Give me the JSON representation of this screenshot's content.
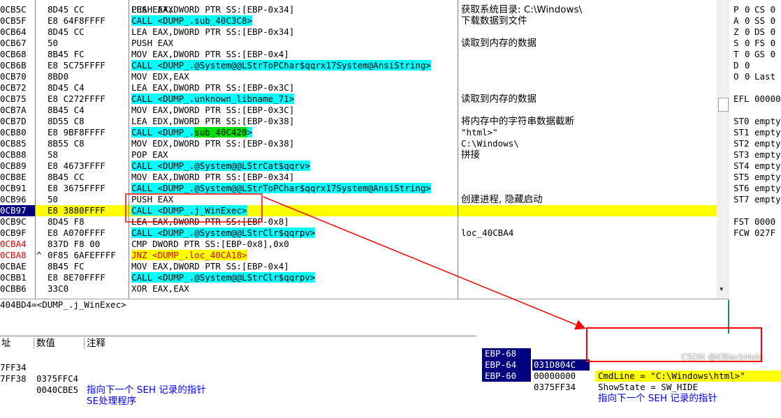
{
  "disasm": {
    "rows": [
      {
        "addr": "0CB5C",
        "mark": "",
        "hex": "8D45 CC",
        "ins": "LEA EAX,DWORD PTR SS:[EBP-0x34]",
        "cmt": "获取系统目录: C:\\Windows\\"
      },
      {
        "addr": "0CB5F",
        "mark": "",
        "hex": "E8 64F8FFFF",
        "ins": "CALL <DUMP_.sub_40C3C8>",
        "cmt": ""
      },
      {
        "addr": "0CB64",
        "mark": "",
        "hex": "8D45 CC",
        "ins": "LEA EAX,DWORD PTR SS:[EBP-0x34]",
        "cmt": ""
      },
      {
        "addr": "0CB67",
        "mark": "",
        "hex": "50",
        "ins": "PUSH EAX",
        "cmt": "读取到内存的数据"
      },
      {
        "addr": "0CB68",
        "mark": "",
        "hex": "8B45 FC",
        "ins": "MOV EAX,DWORD PTR SS:[EBP-0x4]",
        "cmt": ""
      },
      {
        "addr": "0CB6B",
        "mark": "",
        "hex": "E8 5C75FFFF",
        "ins": "CALL <DUMP_.@System@@LStrToPChar$qqrx17System@AnsiString>",
        "cmt": ""
      },
      {
        "addr": "0CB70",
        "mark": "",
        "hex": "8BD0",
        "ins": "MOV EDX,EAX",
        "cmt": ""
      },
      {
        "addr": "0CB72",
        "mark": "",
        "hex": "8D45 C4",
        "ins": "LEA EAX,DWORD PTR SS:[EBP-0x3C]",
        "cmt": ""
      },
      {
        "addr": "0CB75",
        "mark": "",
        "hex": "E8 C272FFFF",
        "ins": "CALL <DUMP_.unknown_libname_71>",
        "cmt": "读取到内存的数据"
      },
      {
        "addr": "0CB7A",
        "mark": "",
        "hex": "8B45 C4",
        "ins": "MOV EAX,DWORD PTR SS:[EBP-0x3C]",
        "cmt": ""
      },
      {
        "addr": "0CB7D",
        "mark": "",
        "hex": "8D55 C8",
        "ins": "LEA EDX,DWORD PTR SS:[EBP-0x38]",
        "cmt": "将内存中的字符串数据截断"
      },
      {
        "addr": "0CB80",
        "mark": "",
        "hex": "E8 9BF8FFFF",
        "ins": "CALL <DUMP_.sub_40C420>",
        "cmt": "\"html>\""
      },
      {
        "addr": "0CB85",
        "mark": "",
        "hex": "8B55 C8",
        "ins": "MOV EDX,DWORD PTR SS:[EBP-0x38]",
        "cmt": "C:\\Windows\\"
      },
      {
        "addr": "0CB88",
        "mark": "",
        "hex": "58",
        "ins": "POP EAX",
        "cmt": "拼接"
      },
      {
        "addr": "0CB89",
        "mark": "",
        "hex": "E8 4673FFFF",
        "ins": "CALL <DUMP_.@System@@LStrCat$qqrv>",
        "cmt": ""
      },
      {
        "addr": "0CB8E",
        "mark": "",
        "hex": "8B45 CC",
        "ins": "MOV EAX,DWORD PTR SS:[EBP-0x34]",
        "cmt": ""
      },
      {
        "addr": "0CB91",
        "mark": "",
        "hex": "E8 3675FFFF",
        "ins": "CALL <DUMP_.@System@@LStrToPChar$qqrx17System@AnsiString>",
        "cmt": ""
      },
      {
        "addr": "0CB96",
        "mark": "",
        "hex": "50",
        "ins": "PUSH EAX",
        "cmt": "创建进程, 隐藏启动"
      },
      {
        "addr": "0CB97",
        "mark": "",
        "hex": "E8 3880FFFF",
        "ins": "CALL <DUMP_.j_WinExec>",
        "cmt": ""
      },
      {
        "addr": "0CB9C",
        "mark": "",
        "hex": "8D45 F8",
        "ins": "LEA EAX,DWORD PTR SS:[EBP-0x8]",
        "cmt": ""
      },
      {
        "addr": "0CB9F",
        "mark": "",
        "hex": "E8 A070FFFF",
        "ins": "CALL <DUMP_.@System@@LStrClr$qqrpv>",
        "cmt": "loc_40CBA4"
      },
      {
        "addr": "0CBA4",
        "mark": "",
        "hex": "837D F8 00",
        "ins": "CMP DWORD PTR SS:[EBP-0x8],0x0",
        "cmt": ""
      },
      {
        "addr": "0CBA8",
        "mark": "^",
        "hex": "0F85 6AFEFFFF",
        "ins": "JNZ <DUMP_.loc_40CA18>",
        "cmt": ""
      },
      {
        "addr": "0CBAE",
        "mark": "",
        "hex": "8B45 FC",
        "ins": "MOV EAX,DWORD PTR SS:[EBP-0x4]",
        "cmt": ""
      },
      {
        "addr": "0CBB1",
        "mark": "",
        "hex": "E8 8E70FFFF",
        "ins": "CALL <DUMP_.@System@@LStrClr$qqrpv>",
        "cmt": ""
      },
      {
        "addr": "0CBB6",
        "mark": "",
        "hex": "33C0",
        "ins": "XOR EAX,EAX",
        "cmt": ""
      }
    ],
    "top_comment": "下载数据到文件"
  },
  "registers": [
    {
      "a": "P",
      "b": "0",
      "c": "CS 0"
    },
    {
      "a": "A",
      "b": "0",
      "c": "SS 0"
    },
    {
      "a": "Z",
      "b": "0",
      "c": "DS 0"
    },
    {
      "a": "S",
      "b": "0",
      "c": "FS 0"
    },
    {
      "a": "T",
      "b": "0",
      "c": "GS 0"
    },
    {
      "a": "D",
      "b": "0",
      "c": ""
    },
    {
      "a": "O",
      "b": "0",
      "c": "Last"
    },
    {
      "a": "",
      "b": "",
      "c": ""
    },
    {
      "a": "EFL",
      "b": "",
      "c": "00000"
    },
    {
      "a": "",
      "b": "",
      "c": ""
    },
    {
      "a": "ST0",
      "b": "",
      "c": "empty"
    },
    {
      "a": "ST1",
      "b": "",
      "c": "empty"
    },
    {
      "a": "ST2",
      "b": "",
      "c": "empty"
    },
    {
      "a": "ST3",
      "b": "",
      "c": "empty"
    },
    {
      "a": "ST4",
      "b": "",
      "c": "empty"
    },
    {
      "a": "ST5",
      "b": "",
      "c": "empty"
    },
    {
      "a": "ST6",
      "b": "",
      "c": "empty"
    },
    {
      "a": "ST7",
      "b": "",
      "c": "empty"
    },
    {
      "a": "",
      "b": "",
      "c": ""
    },
    {
      "a": "FST",
      "b": "",
      "c": "0000"
    },
    {
      "a": "FCW",
      "b": "",
      "c": "027F"
    }
  ],
  "info_line": "404BD4=<DUMP_.j_WinExec>",
  "stack_left": {
    "headers": [
      "址",
      "数值",
      "注释"
    ],
    "rows": [
      {
        "addr": "7FF34",
        "val": "0375FFC4",
        "cmt": "指向下一个 SEH 记录的指针"
      },
      {
        "addr": "7FF38",
        "val": "0040CBE5",
        "cmt": "SE处理程序"
      }
    ]
  },
  "stack_right": {
    "rows": [
      {
        "ebp": "EBP-68",
        "val": "031D804C",
        "cmt": "CmdLine = \"C:\\Windows\\html>\""
      },
      {
        "ebp": "EBP-64",
        "val": "00000000",
        "cmt": "ShowState = SW_HIDE"
      },
      {
        "ebp": "EBP-60",
        "val": "0375FF34",
        "cmt": "指向下一个 SEH 记录的指针"
      }
    ]
  },
  "watermark": "CSDN @KBlackHole",
  "colors": {
    "call_highlight": "#00ffff",
    "current_line": "#ffff00",
    "annotation": "#ff0000",
    "selection": "#000080"
  }
}
